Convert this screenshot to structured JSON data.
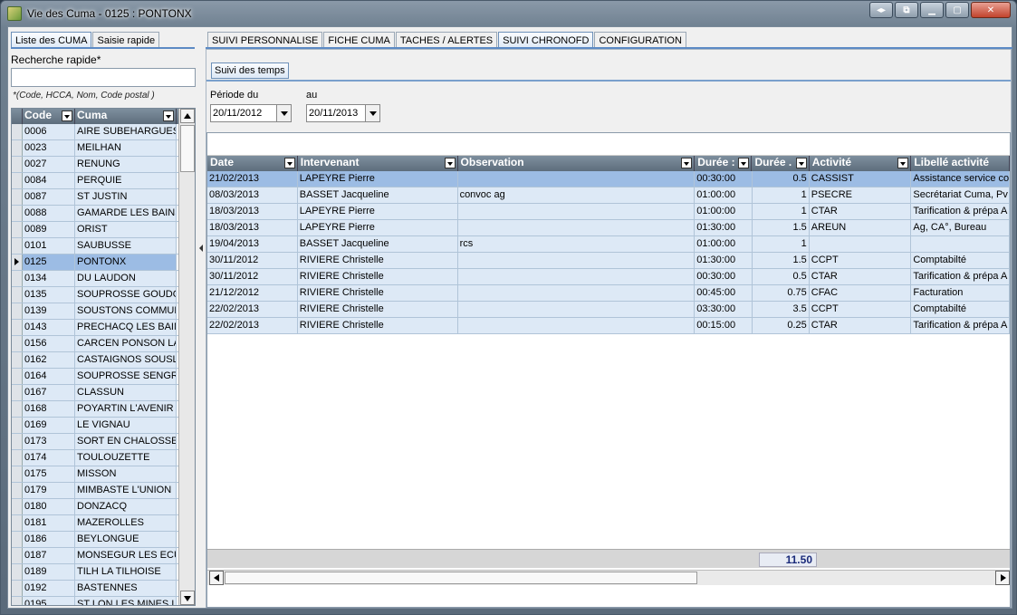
{
  "window": {
    "title": "Vie des Cuma - 0125 : PONTONX"
  },
  "left_tabs": [
    "Liste des CUMA",
    "Saisie rapide"
  ],
  "search": {
    "label": "Recherche rapide*",
    "value": "",
    "hint": "*(Code, HCCA, Nom, Code postal )"
  },
  "cuma_list": {
    "headers": {
      "code": "Code",
      "cuma": "Cuma"
    },
    "rows": [
      {
        "code": "0006",
        "cuma": "AIRE SUBEHARGUES"
      },
      {
        "code": "0023",
        "cuma": "MEILHAN"
      },
      {
        "code": "0027",
        "cuma": "RENUNG"
      },
      {
        "code": "0084",
        "cuma": "PERQUIE"
      },
      {
        "code": "0087",
        "cuma": "ST JUSTIN"
      },
      {
        "code": "0088",
        "cuma": "GAMARDE LES BAINS"
      },
      {
        "code": "0089",
        "cuma": "ORIST"
      },
      {
        "code": "0101",
        "cuma": "SAUBUSSE"
      },
      {
        "code": "0125",
        "cuma": "PONTONX",
        "selected": true
      },
      {
        "code": "0134",
        "cuma": "DU LAUDON"
      },
      {
        "code": "0135",
        "cuma": "SOUPROSSE GOUDOSS"
      },
      {
        "code": "0139",
        "cuma": "SOUSTONS COMMUNA"
      },
      {
        "code": "0143",
        "cuma": "PRECHACQ LES BAINS"
      },
      {
        "code": "0156",
        "cuma": "CARCEN PONSON LA M"
      },
      {
        "code": "0162",
        "cuma": "CASTAIGNOS SOUSLEN"
      },
      {
        "code": "0164",
        "cuma": "SOUPROSSE SENGRES"
      },
      {
        "code": "0167",
        "cuma": "CLASSUN"
      },
      {
        "code": "0168",
        "cuma": "POYARTIN L'AVENIR"
      },
      {
        "code": "0169",
        "cuma": "LE VIGNAU"
      },
      {
        "code": "0173",
        "cuma": "SORT EN CHALOSSE"
      },
      {
        "code": "0174",
        "cuma": "TOULOUZETTE"
      },
      {
        "code": "0175",
        "cuma": "MISSON"
      },
      {
        "code": "0179",
        "cuma": "MIMBASTE L'UNION"
      },
      {
        "code": "0180",
        "cuma": "DONZACQ"
      },
      {
        "code": "0181",
        "cuma": "MAZEROLLES"
      },
      {
        "code": "0186",
        "cuma": "BEYLONGUE"
      },
      {
        "code": "0187",
        "cuma": "MONSEGUR LES ECURE"
      },
      {
        "code": "0189",
        "cuma": "TILH LA TILHOISE"
      },
      {
        "code": "0192",
        "cuma": "BASTENNES"
      },
      {
        "code": "0195",
        "cuma": "ST LON LES MINES LA L"
      }
    ]
  },
  "main_tabs": [
    "SUIVI PERSONNALISE",
    "FICHE CUMA",
    "TACHES / ALERTES",
    "SUIVI CHRONOFD",
    "CONFIGURATION"
  ],
  "active_main_tab": "SUIVI CHRONOFD",
  "sub_tab": "Suivi des temps",
  "period": {
    "from_label": "Période du",
    "from_value": "20/11/2012",
    "to_label": "au",
    "to_value": "20/11/2013"
  },
  "time_grid": {
    "headers": {
      "date": "Date",
      "intervenant": "Intervenant",
      "observation": "Observation",
      "duree1": "Durée :",
      "duree2": "Durée .",
      "activite": "Activité",
      "libelle": "Libellé activité"
    },
    "rows": [
      {
        "date": "21/02/2013",
        "intervenant": "LAPEYRE Pierre",
        "observation": "",
        "duree1": "00:30:00",
        "duree2": "0.5",
        "activite": "CASSIST",
        "libelle": "Assistance service co",
        "selected": true
      },
      {
        "date": "08/03/2013",
        "intervenant": "BASSET Jacqueline",
        "observation": "convoc ag",
        "duree1": "01:00:00",
        "duree2": "1",
        "activite": "PSECRE",
        "libelle": "Secrétariat Cuma, Pv"
      },
      {
        "date": "18/03/2013",
        "intervenant": "LAPEYRE Pierre",
        "observation": "",
        "duree1": "01:00:00",
        "duree2": "1",
        "activite": "CTAR",
        "libelle": "Tarification & prépa A"
      },
      {
        "date": "18/03/2013",
        "intervenant": "LAPEYRE Pierre",
        "observation": "",
        "duree1": "01:30:00",
        "duree2": "1.5",
        "activite": "AREUN",
        "libelle": "Ag, CA°, Bureau"
      },
      {
        "date": "19/04/2013",
        "intervenant": "BASSET Jacqueline",
        "observation": "rcs",
        "duree1": "01:00:00",
        "duree2": "1",
        "activite": "",
        "libelle": ""
      },
      {
        "date": "30/11/2012",
        "intervenant": "RIVIERE Christelle",
        "observation": "",
        "duree1": "01:30:00",
        "duree2": "1.5",
        "activite": "CCPT",
        "libelle": "Comptabilté"
      },
      {
        "date": "30/11/2012",
        "intervenant": "RIVIERE Christelle",
        "observation": "",
        "duree1": "00:30:00",
        "duree2": "0.5",
        "activite": "CTAR",
        "libelle": "Tarification & prépa A"
      },
      {
        "date": "21/12/2012",
        "intervenant": "RIVIERE Christelle",
        "observation": "",
        "duree1": "00:45:00",
        "duree2": "0.75",
        "activite": "CFAC",
        "libelle": "Facturation"
      },
      {
        "date": "22/02/2013",
        "intervenant": "RIVIERE Christelle",
        "observation": "",
        "duree1": "03:30:00",
        "duree2": "3.5",
        "activite": "CCPT",
        "libelle": "Comptabilté"
      },
      {
        "date": "22/02/2013",
        "intervenant": "RIVIERE Christelle",
        "observation": "",
        "duree1": "00:15:00",
        "duree2": "0.25",
        "activite": "CTAR",
        "libelle": "Tarification & prépa A"
      }
    ],
    "total": "11.50"
  }
}
